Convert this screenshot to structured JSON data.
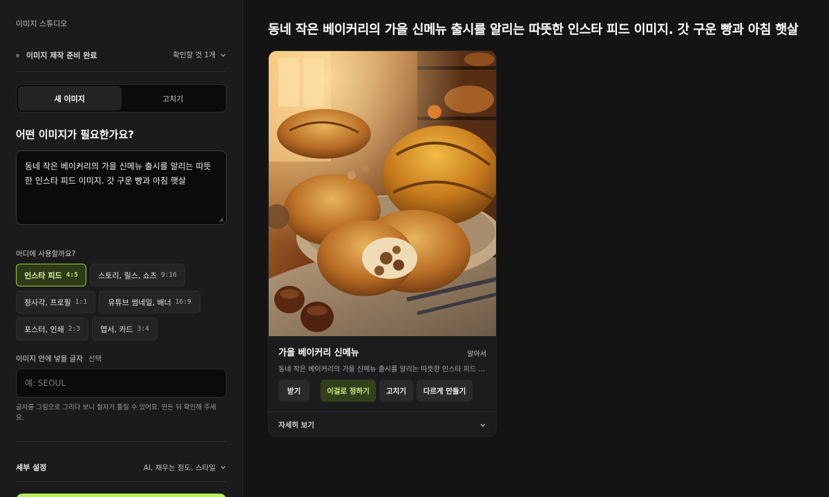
{
  "sidebar": {
    "studio_title": "이미지 스튜디오",
    "status": {
      "label": "이미지 제작 준비 완료",
      "check_label": "확인할 것 1개"
    },
    "mode_tabs": [
      {
        "label": "새 이미지",
        "active": true
      },
      {
        "label": "고치기",
        "active": false
      }
    ],
    "question": "어떤 이미지가 필요한가요?",
    "prompt_value": "동네 작은 베이커리의 가을 신메뉴 출시를 알리는 따뜻한 인스타 피드 이미지. 갓 구운 빵과 아침 햇살",
    "usage_label": "어디에 사용할까요?",
    "usage_options": [
      {
        "label": "인스타 피드",
        "ratio": "4:5",
        "selected": true
      },
      {
        "label": "스토리, 릴스, 쇼츠",
        "ratio": "9:16",
        "selected": false
      },
      {
        "label": "정사각, 프로필",
        "ratio": "1:1",
        "selected": false
      },
      {
        "label": "유튜브 썸네일, 배너",
        "ratio": "16:9",
        "selected": false
      },
      {
        "label": "포스터, 인쇄",
        "ratio": "2:3",
        "selected": false
      },
      {
        "label": "엽서, 카드",
        "ratio": "3:4",
        "selected": false
      }
    ],
    "text_label": "이미지 안에 넣을 글자",
    "text_optional": "선택",
    "text_placeholder": "예: SEOUL",
    "text_hint": "글자를 그림으로 그리다 보니 철자가 틀릴 수 있어요. 만든 뒤 확인해 주세요.",
    "detail_label": "세부 설정",
    "detail_summary": "AI, 채우는 정도, 스타일"
  },
  "main": {
    "headline": "동네 작은 베이커리의 가을 신메뉴 출시를 알리는 따뜻한 인스타 피드 이미지. 갓 구운 빵과 아침 햇살",
    "card": {
      "title": "가을 베이커리 신메뉴",
      "mode": "알아서",
      "description": "동네 작은 베이커리의 가을 신메뉴 출시를 알리는 따뜻한 인스타 피드 이미지. 갓 구운 빵과 아침 햇살",
      "actions": {
        "download": "받기",
        "choose": "이걸로 정하기",
        "edit": "고치기",
        "variant": "다르게 만들기"
      },
      "detail_toggle": "자세히 보기"
    }
  },
  "colors": {
    "accent": "#b8ec5b",
    "selected_chip_border": "#9fcf3a",
    "background": "#141414",
    "sidebar": "#1b1b1c"
  }
}
